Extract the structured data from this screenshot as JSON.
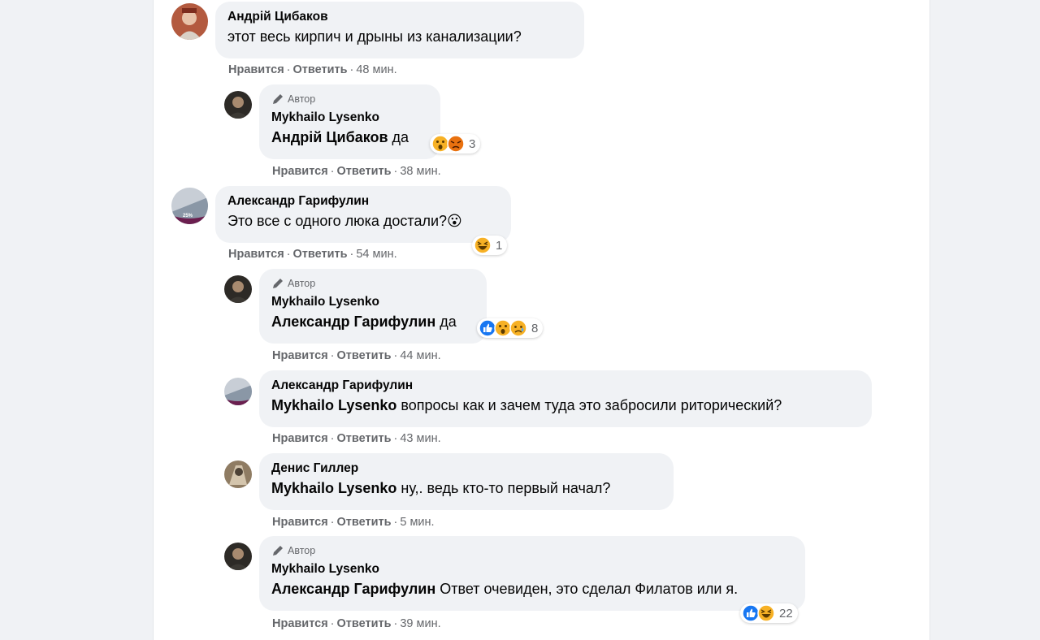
{
  "comments": [
    {
      "id": "c1",
      "author": "Андрій Цибаков",
      "text": "этот весь кирпич и дрыны из канализации?",
      "like": "Нравится",
      "reply": "Ответить",
      "time": "48 мин."
    },
    {
      "id": "c2",
      "author_badge": "Автор",
      "author": "Mykhailo Lysenko",
      "mention": "Андрій Цибаков",
      "text": " да",
      "like": "Нравится",
      "reply": "Ответить",
      "time": "38 мин.",
      "reactions": {
        "count": "3",
        "icons": [
          "wow-icon",
          "angry-icon"
        ]
      }
    },
    {
      "id": "c3",
      "author": "Александр Гарифулин",
      "text": "Это все с одного люка достали?😮",
      "like": "Нравится",
      "reply": "Ответить",
      "time": "54 мин.",
      "reactions": {
        "count": "1",
        "icons": [
          "haha-icon"
        ]
      }
    },
    {
      "id": "c4",
      "author_badge": "Автор",
      "author": "Mykhailo Lysenko",
      "mention": "Александр Гарифулин",
      "text": " да",
      "like": "Нравится",
      "reply": "Ответить",
      "time": "44 мин.",
      "reactions": {
        "count": "8",
        "icons": [
          "like-icon",
          "wow-icon",
          "sad-icon"
        ]
      }
    },
    {
      "id": "c5",
      "author": "Александр Гарифулин",
      "mention": "Mykhailo Lysenko",
      "text": " вопросы как и зачем туда это забросили риторический?",
      "like": "Нравится",
      "reply": "Ответить",
      "time": "43 мин."
    },
    {
      "id": "c6",
      "author": "Денис Гиллер",
      "mention": "Mykhailo Lysenko",
      "text": " ну,. ведь кто-то первый начал?",
      "like": "Нравится",
      "reply": "Ответить",
      "time": "5 мин."
    },
    {
      "id": "c7",
      "author_badge": "Автор",
      "author": "Mykhailo Lysenko",
      "mention": "Александр Гарифулин",
      "text": " Ответ очевиден, это сделал Филатов или я.",
      "like": "Нравится",
      "reply": "Ответить",
      "time": "39 мин.",
      "reactions": {
        "count": "22",
        "icons": [
          "like-icon",
          "haha-icon"
        ]
      }
    }
  ],
  "avatar_badge": "25%",
  "separator": "·",
  "colors": {
    "page_bg": "#f0f2f5",
    "bubble": "#f0f2f5",
    "secondary_text": "#65676b",
    "like_blue": "#1877f2",
    "emoji_yellow": "#f7b125"
  }
}
